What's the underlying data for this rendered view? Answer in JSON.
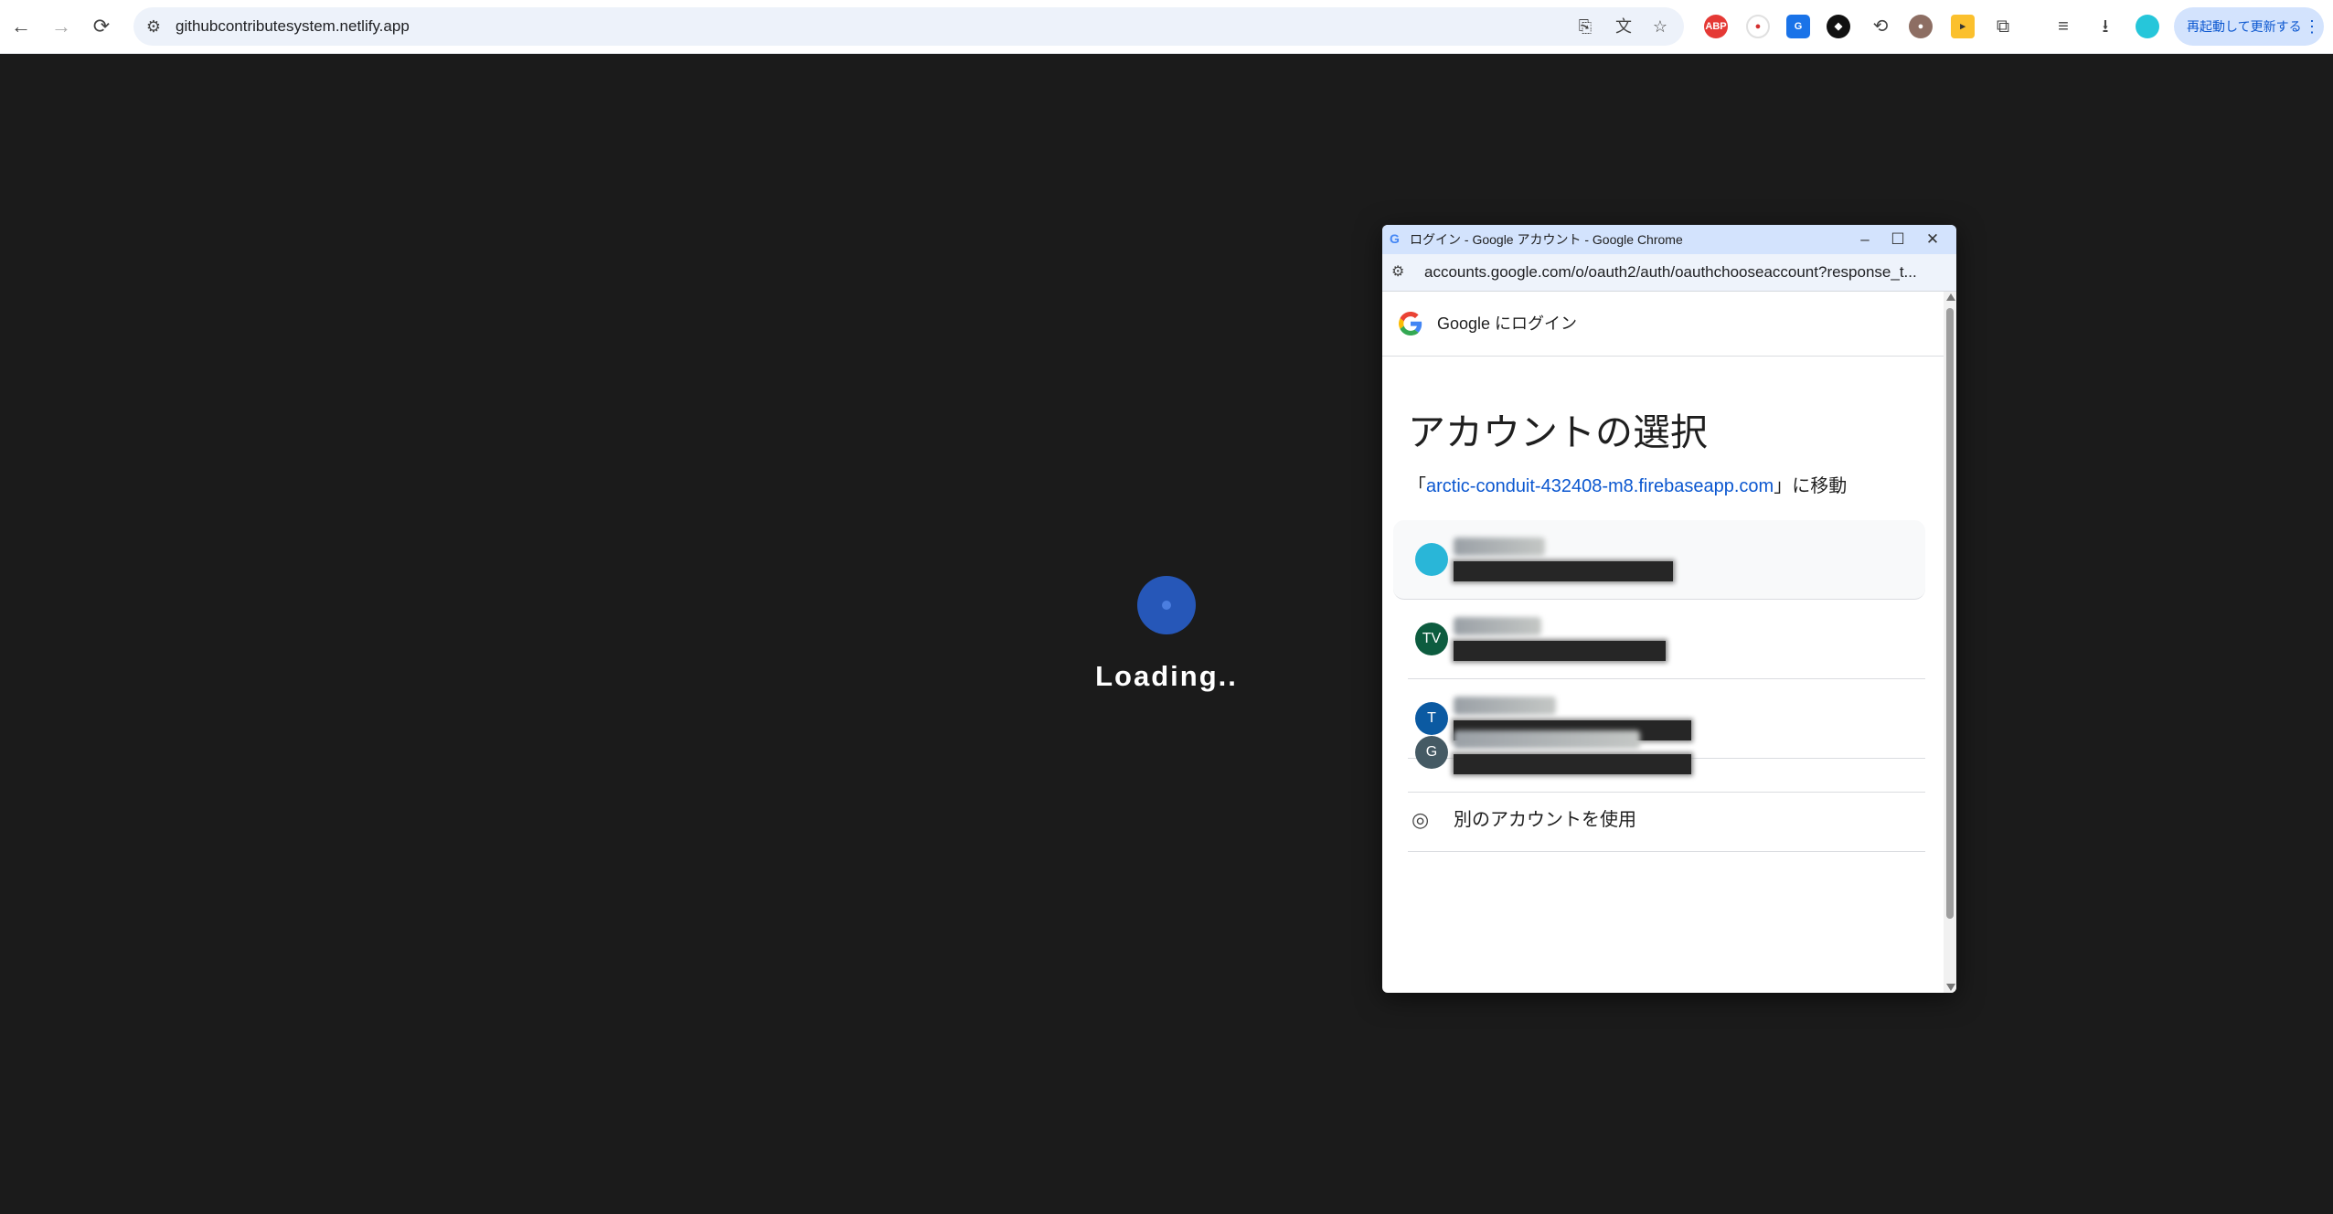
{
  "browser": {
    "url": "githubcontributesystem.netlify.app",
    "relaunch_label": "再起動して更新する",
    "menu_icon": "⋮",
    "nav": {
      "back_icon": "←",
      "forward_icon": "→",
      "reload_icon": "⟳"
    },
    "ext_abp": "ABP"
  },
  "page": {
    "loading_text": "Loading.."
  },
  "popup": {
    "window_title": "ログイン - Google アカウント - Google Chrome",
    "address": "accounts.google.com/o/oauth2/auth/oauthchooseaccount?response_t...",
    "header_text": "Google にログイン",
    "heading": "アカウントの選択",
    "subtitle_prefix": "「",
    "subtitle_link": "arctic-conduit-432408-m8.firebaseapp.com",
    "subtitle_suffix": "」に移動",
    "accounts": [
      {
        "avatar_text": "",
        "avatar_color": "#29b6d8"
      },
      {
        "avatar_text": "TV",
        "avatar_color": "#0d5c3f"
      },
      {
        "avatar_text": "T",
        "avatar_color": "#0b5aa2"
      },
      {
        "avatar_text": "G",
        "avatar_color": "#455a64"
      }
    ],
    "use_another": "別のアカウントを使用"
  }
}
